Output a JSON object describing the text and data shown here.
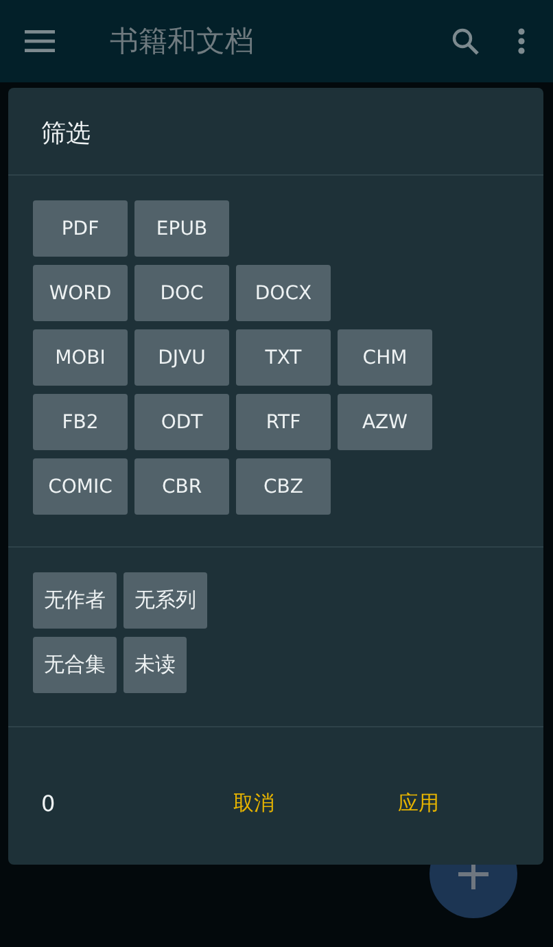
{
  "app_bar": {
    "title": "书籍和文档"
  },
  "dialog": {
    "title": "筛选",
    "format_rows": [
      [
        "PDF",
        "EPUB"
      ],
      [
        "WORD",
        "DOC",
        "DOCX"
      ],
      [
        "MOBI",
        "DJVU",
        "TXT",
        "CHM"
      ],
      [
        "FB2",
        "ODT",
        "RTF",
        "AZW"
      ],
      [
        "COMIC",
        "CBR",
        "CBZ"
      ]
    ],
    "tag_rows": [
      [
        "无作者",
        "无系列"
      ],
      [
        "无合集",
        "未读"
      ]
    ],
    "count": "0",
    "buttons": [
      "取消",
      "应用"
    ]
  }
}
